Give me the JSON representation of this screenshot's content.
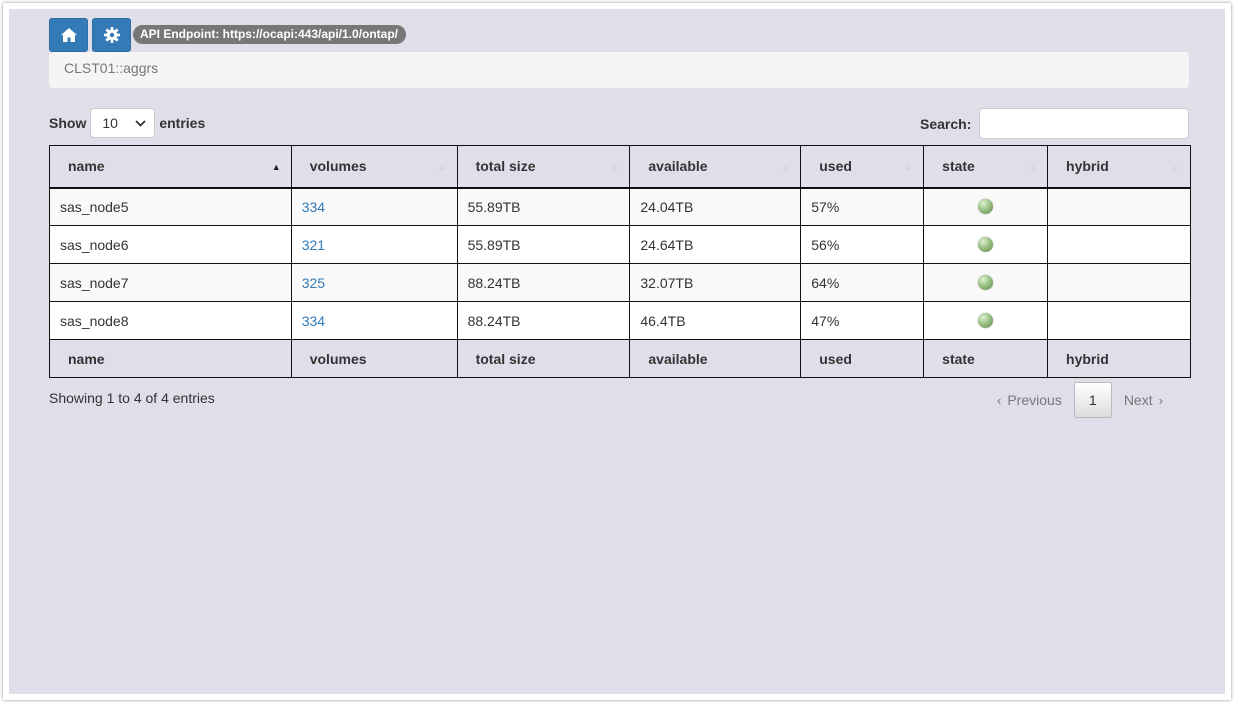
{
  "header": {
    "api_endpoint": "API Endpoint: https://ocapi:443/api/1.0/ontap/",
    "breadcrumb": "CLST01::aggrs"
  },
  "icons": {
    "home": "home-icon",
    "settings": "gear-icon"
  },
  "colors": {
    "primary": "#337ab7",
    "link": "#337ab7",
    "badge": "#777777",
    "background": "#dfdfea"
  },
  "length_control": {
    "show_label": "Show",
    "value": "10",
    "entries_label": "entries"
  },
  "search": {
    "label": "Search:",
    "value": ""
  },
  "table": {
    "columns": [
      "name",
      "volumes",
      "total size",
      "available",
      "used",
      "state",
      "hybrid"
    ],
    "sorted_column": "name",
    "sort_direction": "ascending",
    "rows": [
      {
        "name": "sas_node5",
        "volumes": "334",
        "total_size": "55.89TB",
        "available": "24.04TB",
        "used": "57%",
        "state": "online",
        "hybrid": ""
      },
      {
        "name": "sas_node6",
        "volumes": "321",
        "total_size": "55.89TB",
        "available": "24.64TB",
        "used": "56%",
        "state": "online",
        "hybrid": ""
      },
      {
        "name": "sas_node7",
        "volumes": "325",
        "total_size": "88.24TB",
        "available": "32.07TB",
        "used": "64%",
        "state": "online",
        "hybrid": ""
      },
      {
        "name": "sas_node8",
        "volumes": "334",
        "total_size": "88.24TB",
        "available": "46.4TB",
        "used": "47%",
        "state": "online",
        "hybrid": ""
      }
    ]
  },
  "footer": {
    "info": "Showing 1 to 4 of 4 entries",
    "previous_label": "Previous",
    "current_page": "1",
    "next_label": "Next"
  }
}
